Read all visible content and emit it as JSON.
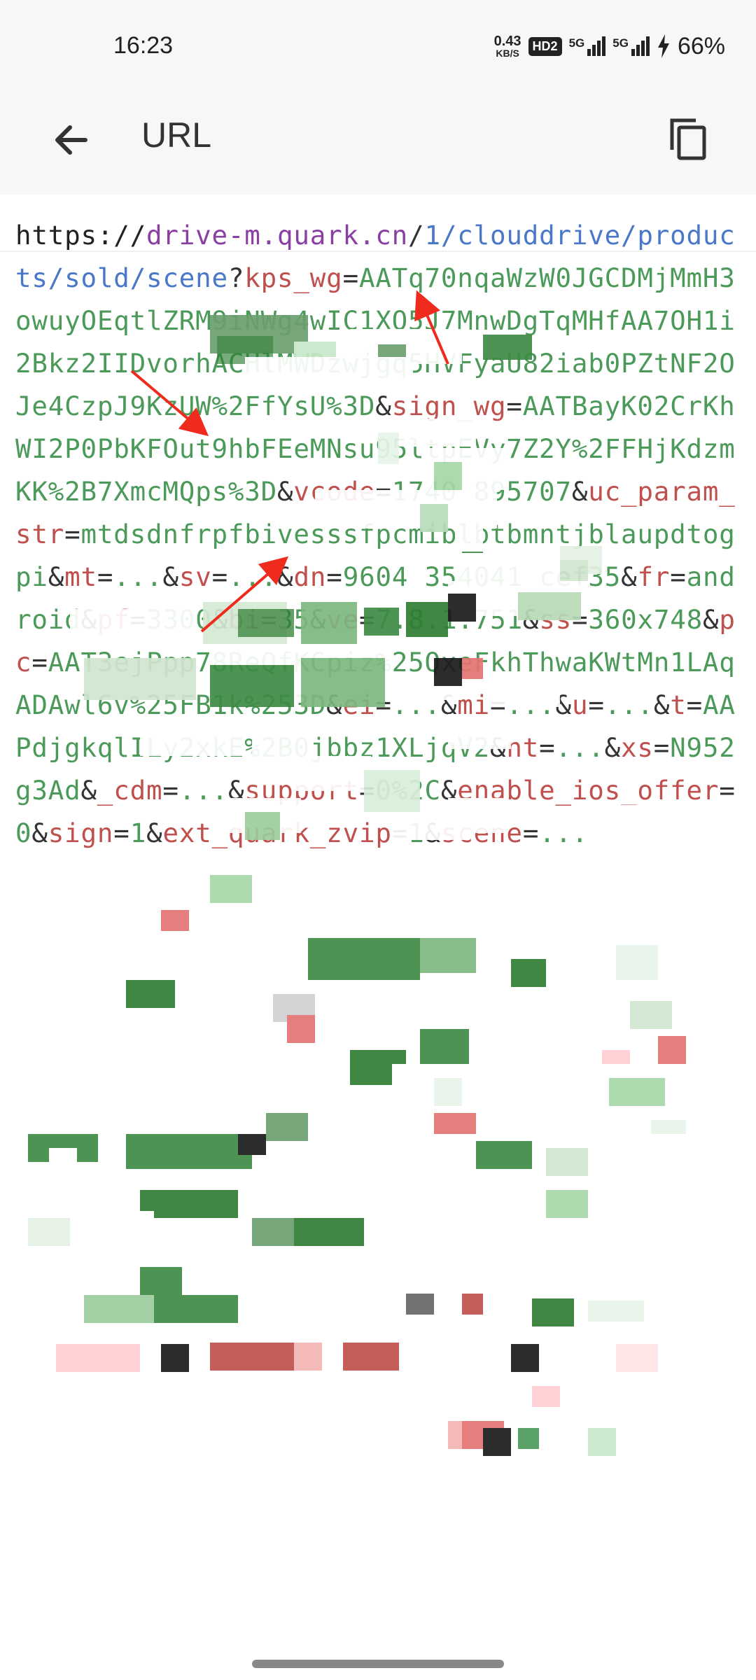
{
  "status_bar": {
    "time": "16:23",
    "net_speed_value": "0.43",
    "net_speed_unit": "KB/S",
    "hd_badge": "HD2",
    "sim1_label": "5G",
    "sim2_label": "5G",
    "battery_percent": "66%"
  },
  "app_bar": {
    "title": "URL",
    "back_icon": "arrow-left-icon",
    "copy_icon": "copy-icon"
  },
  "url": {
    "scheme": "https://",
    "host": "drive-m.quark.cn",
    "path_slash": "/",
    "path": "1/clouddrive/products/sold/scene",
    "query_mark": "?",
    "params": [
      {
        "key": "kps_wg",
        "value": "AATq70nqaWzW0JGCDMjMmH3owuyOEqtlZRM9iNWg4wIC1XO5J7MnwDgTqMHfAA7OH1i2Bkz2IIDvorhACHlMWDzwjgq5HVFyaU82iab0PZtNF2OJe4CzpJ9KzUW%2FfYsU%3D"
      },
      {
        "key": "sign_wg",
        "value": "AATBayK02CrKhWI2P0PbKFOut9hbFEeMNsu95ltpEVy7Z2Y%2FFHjKdzmKK%2B7XmcMQps%3D"
      },
      {
        "key": "vcode",
        "value": "1740 895707"
      },
      {
        "key": "uc_param_str",
        "value": "mtdsdnfrpfbivesssfpcmiblbtbmntjblaupdtogpi"
      },
      {
        "key": "mt",
        "value": "..."
      },
      {
        "key": "sv",
        "value": "..."
      },
      {
        "key": "dn",
        "value": "9604 354041 cef35"
      },
      {
        "key": "fr",
        "value": "android"
      },
      {
        "key": "pf",
        "value": "3300"
      },
      {
        "key": "bi",
        "value": "35"
      },
      {
        "key": "ve",
        "value": "7.8.1.751"
      },
      {
        "key": "ss",
        "value": "360x748"
      },
      {
        "key": "pc",
        "value": "AAT3ejPpp78ReQfKCpiz%25QxeFkhThwaKWtMn1LAqADAwl6v%25FB1k%253D"
      },
      {
        "key": "ei",
        "value": "..."
      },
      {
        "key": "mi",
        "value": "..."
      },
      {
        "key": "u",
        "value": "..."
      },
      {
        "key": "t",
        "value": "AAPdjgkqlILy2xkE%2B0jbbz1XLjqV2"
      },
      {
        "key": "nt",
        "value": "..."
      },
      {
        "key": "xs",
        "value": "N952g3Ad"
      },
      {
        "key": "_cdm",
        "value": "..."
      },
      {
        "key": "support",
        "value": "0%2C"
      },
      {
        "key": "enable_ios_offer",
        "value": "0"
      },
      {
        "key": "sign",
        "value": "1"
      },
      {
        "key": "ext_quark_zvip",
        "value": "1"
      },
      {
        "key": "scene",
        "value": "..."
      }
    ]
  },
  "colors": {
    "scheme": "#222222",
    "host": "#8a3fa3",
    "path": "#4a78c8",
    "key": "#c0504d",
    "value": "#4c9a5a",
    "annotation_arrow": "#ee2b1c",
    "chrome_background": "#f7f7f7"
  }
}
